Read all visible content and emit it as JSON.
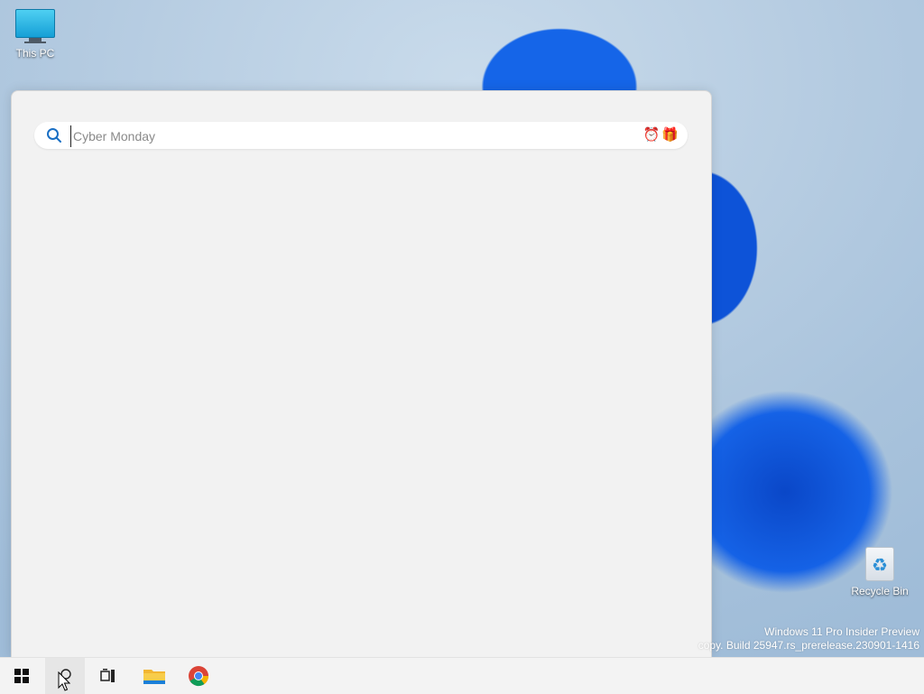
{
  "desktop": {
    "icons": [
      {
        "label": "This PC",
        "icon": "this-pc-icon"
      },
      {
        "label": "Recycle Bin",
        "icon": "recycle-bin-icon"
      }
    ],
    "watermark": {
      "line1": "Windows 11 Pro Insider Preview",
      "line2": "copy. Build 25947.rs_prerelease.230901-1416"
    }
  },
  "search_panel": {
    "search_input": {
      "value": "",
      "placeholder": "Cyber Monday"
    },
    "search_highlight_icons": [
      "alarm-clock-icon",
      "gift-icon"
    ]
  },
  "taskbar": {
    "items": [
      {
        "name": "start-button",
        "icon": "windows-logo-icon"
      },
      {
        "name": "search-button",
        "icon": "search-icon",
        "active": true
      },
      {
        "name": "task-view-button",
        "icon": "task-view-icon"
      },
      {
        "name": "file-explorer-button",
        "icon": "folder-icon"
      },
      {
        "name": "chrome-button",
        "icon": "chrome-icon"
      }
    ]
  },
  "colors": {
    "accent": "#0067c0",
    "panel_bg": "#f2f2f2",
    "taskbar_bg": "#f3f3f3"
  }
}
